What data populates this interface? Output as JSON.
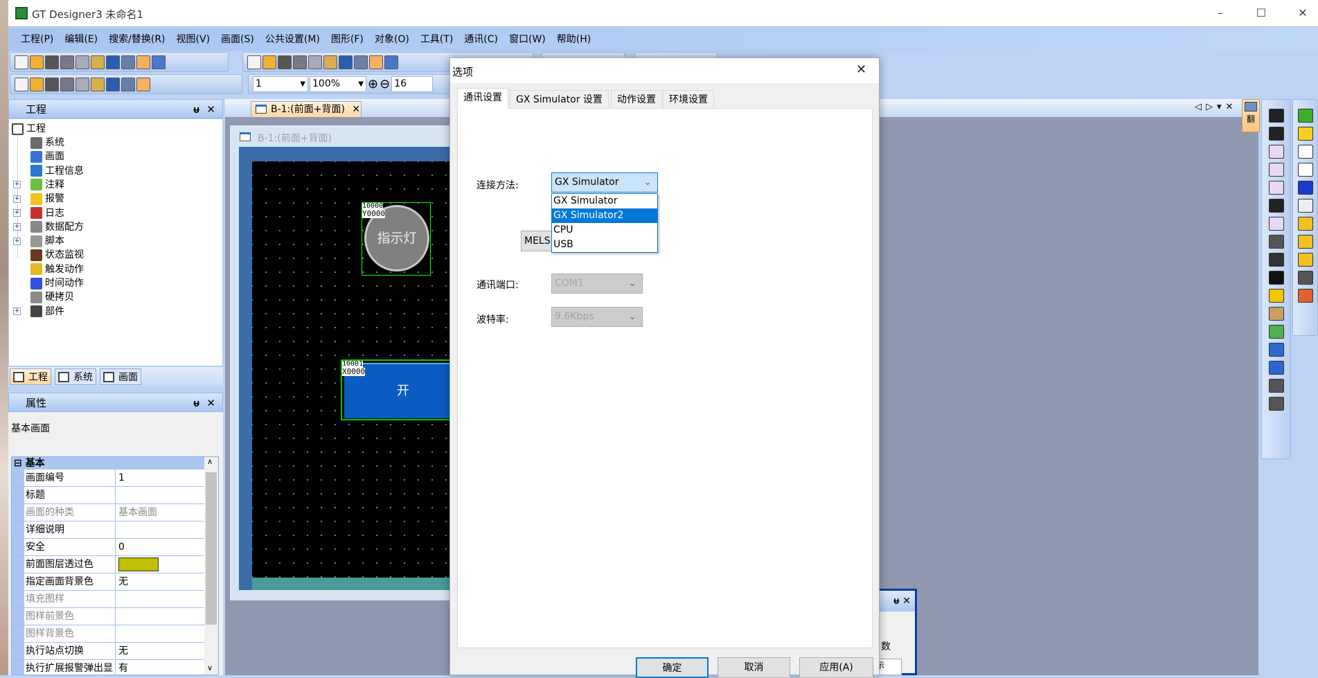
{
  "window": {
    "title": "GT Designer3 未命名1",
    "minimize": "–",
    "maximize": "☐",
    "close": "✕"
  },
  "menu": [
    "工程(P)",
    "编辑(E)",
    "搜索/替换(R)",
    "视图(V)",
    "画面(S)",
    "公共设置(M)",
    "图形(F)",
    "对象(O)",
    "工具(T)",
    "通讯(C)",
    "窗口(W)",
    "帮助(H)"
  ],
  "toolbar1": [
    "new-file-icon",
    "open-folder-icon",
    "save-icon",
    "cut-icon",
    "copy-icon",
    "paste-icon",
    "undo-icon",
    "redo-icon",
    "select-pointer-icon",
    "help-icon"
  ],
  "toolbar1b": [
    "screen-icon",
    "window-screen-icon",
    "system-screen-icon",
    "project-info-icon",
    "data-book-icon",
    "component-icon",
    "data-icon",
    "search-screen-icon",
    "overlap-icon",
    "switch-icon"
  ],
  "toolbar2": [
    "new-screen-icon",
    "open-screen-icon",
    "back-icon",
    "forward-icon",
    "screen-folder-icon",
    "pattern-icon",
    "frame-icon",
    "fill-color-icon",
    "zoom-preview-icon"
  ],
  "zoombar": {
    "screen_no": "1",
    "zoom": "100%",
    "grid": "16"
  },
  "project_panel": {
    "title": "工程",
    "pin": "ᵾ",
    "close": "✕",
    "root": "工程",
    "items": [
      {
        "label": "系统",
        "expandable": false,
        "icon": "system-icon",
        "color": "#6b6b6b"
      },
      {
        "label": "画面",
        "expandable": false,
        "icon": "screen-icon",
        "color": "#3a72d8"
      },
      {
        "label": "工程信息",
        "expandable": false,
        "icon": "info-icon",
        "color": "#2a78d0"
      },
      {
        "label": "注释",
        "expandable": true,
        "icon": "comment-icon",
        "color": "#6cbf3a"
      },
      {
        "label": "报警",
        "expandable": true,
        "icon": "alarm-icon",
        "color": "#f2c21a"
      },
      {
        "label": "日志",
        "expandable": true,
        "icon": "log-icon",
        "color": "#c83030"
      },
      {
        "label": "数据配方",
        "expandable": true,
        "icon": "recipe-book-icon",
        "color": "#888"
      },
      {
        "label": "脚本",
        "expandable": true,
        "icon": "script-icon",
        "color": "#999"
      },
      {
        "label": "状态监视",
        "expandable": false,
        "icon": "eye-icon",
        "color": "#6a3a20"
      },
      {
        "label": "触发动作",
        "expandable": false,
        "icon": "trigger-action-icon",
        "color": "#e8b820"
      },
      {
        "label": "时间动作",
        "expandable": false,
        "icon": "time-action-icon",
        "color": "#3050e0"
      },
      {
        "label": "硬拷贝",
        "expandable": false,
        "icon": "printer-icon",
        "color": "#8a8a8a"
      },
      {
        "label": "部件",
        "expandable": true,
        "icon": "parts-icon",
        "color": "#444"
      }
    ],
    "tabs": [
      "工程",
      "系统",
      "画面"
    ]
  },
  "properties_panel": {
    "title": "属性",
    "subject": "基本画面",
    "category": "基本",
    "rows": [
      {
        "name": "画面编号",
        "value": "1",
        "disabled": false
      },
      {
        "name": "标题",
        "value": "",
        "disabled": false
      },
      {
        "name": "画面的种类",
        "value": "基本画面",
        "disabled": true
      },
      {
        "name": "详细说明",
        "value": "",
        "disabled": false
      },
      {
        "name": "安全",
        "value": "0",
        "disabled": false
      },
      {
        "name": "前面图层透过色",
        "value": "",
        "swatch": "#c0c000",
        "disabled": false
      },
      {
        "name": "指定画面背景色",
        "value": "无",
        "disabled": false
      },
      {
        "name": "填充图样",
        "value": "",
        "disabled": true
      },
      {
        "name": "图样前景色",
        "value": "",
        "disabled": true
      },
      {
        "name": "图样背景色",
        "value": "",
        "disabled": true
      },
      {
        "name": "执行站点切换",
        "value": "无",
        "disabled": false
      },
      {
        "name": "执行扩展报警弹出显",
        "value": "有",
        "disabled": false
      }
    ]
  },
  "editor": {
    "tab": "B-1:(前面+背面)",
    "tab_close": "✕",
    "window_title": "B-1:(前面+背面)",
    "lamp": {
      "label": "指示灯",
      "id": "10000",
      "device": "Y0000"
    },
    "switch": {
      "label": "开",
      "id": "10001",
      "device": "X0000"
    },
    "nav": [
      "◁",
      "▷",
      "▾",
      "✕"
    ]
  },
  "side_toolbox": {
    "label": "翻"
  },
  "dialog": {
    "title": "选项",
    "close": "✕",
    "tabs": [
      "通讯设置",
      "GX Simulator 设置",
      "动作设置",
      "环境设置"
    ],
    "connection_label": "连接方法:",
    "connection_value": "GX Simulator",
    "options": [
      "GX Simulator",
      "GX Simulator2",
      "CPU",
      "USB"
    ],
    "highlighted": 1,
    "mels_button": "MELS",
    "port_label": "通讯端口:",
    "port_value": "COM1",
    "baud_label": "波特率:",
    "baud_value": "9.6Kbps",
    "ok": "确定",
    "cancel": "取消",
    "apply": "应用(A)"
  },
  "bottom_panel": {
    "fragment": "数",
    "fragment2": "示"
  },
  "colors": {
    "accent": "#0078d7",
    "menubar": "#bcd3f5",
    "canvas": "#000000",
    "switch": "#0a5cc0",
    "lamp": "#808080",
    "selection": "#00ff00"
  }
}
